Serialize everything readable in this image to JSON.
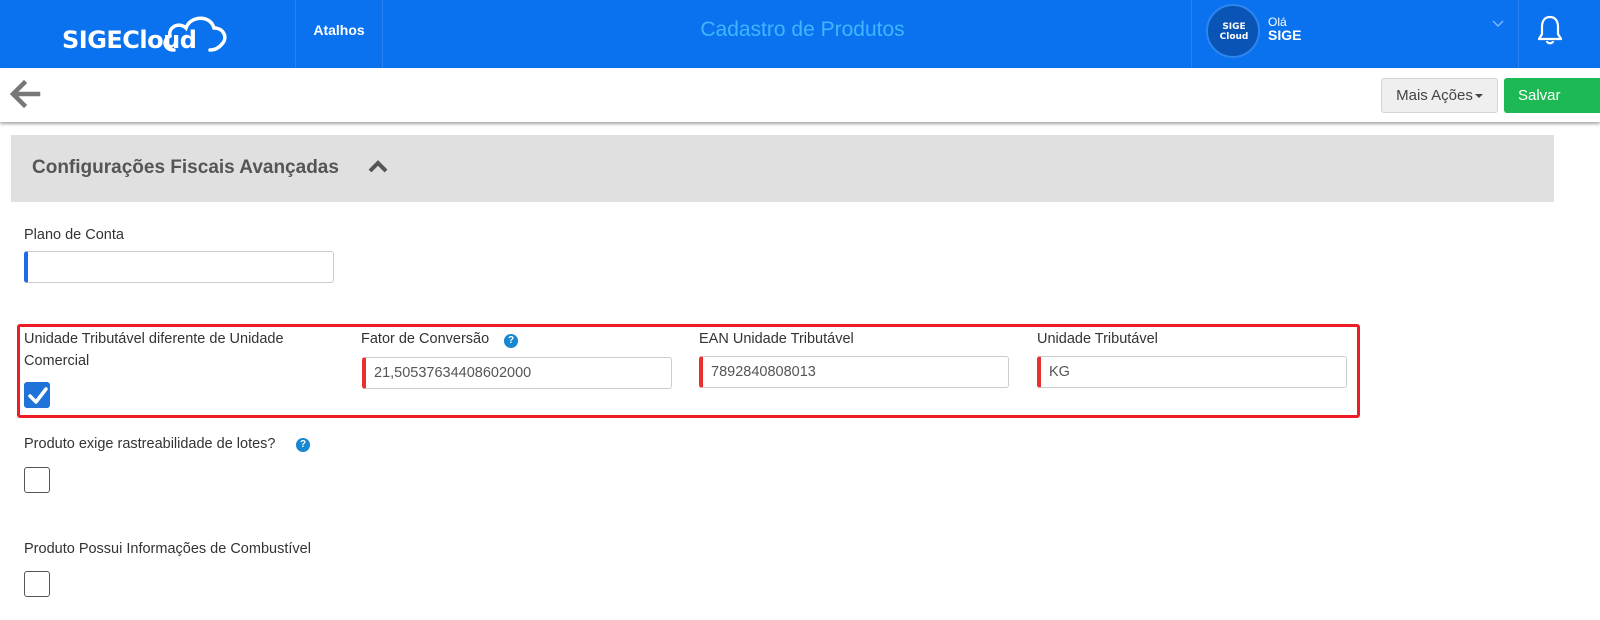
{
  "header": {
    "logo_text": "SIGECloud",
    "shortcuts_label": "Atalhos",
    "page_title": "Cadastro de Produtos",
    "user": {
      "avatar_text": "SIGE Cloud",
      "greeting": "Olá",
      "name": "SIGE"
    },
    "icons": [
      "cloud-icon",
      "chevron-down-icon",
      "bell-icon"
    ]
  },
  "actionbar": {
    "more_actions_label": "Mais Ações",
    "save_label": "Salvar",
    "icons": [
      "back-arrow-icon"
    ]
  },
  "section": {
    "title": "Configurações Fiscais Avançadas",
    "expanded": true,
    "icons": [
      "chevron-up-icon"
    ]
  },
  "form": {
    "plano_de_conta": {
      "label": "Plano de Conta",
      "value": ""
    },
    "unidade_tributavel_diferente": {
      "label_line1": "Unidade Tributável diferente de Unidade",
      "label_line2": "Comercial",
      "checked": true
    },
    "fator_conversao": {
      "label": "Fator de Conversão",
      "value": "21,50537634408602000",
      "help": "?"
    },
    "ean_unidade_tributavel": {
      "label": "EAN Unidade Tributável",
      "value": "7892840808013"
    },
    "unidade_tributavel": {
      "label": "Unidade Tributável",
      "value": "KG"
    },
    "rastreabilidade": {
      "label": "Produto exige rastreabilidade de lotes?",
      "checked": false,
      "help": "?"
    },
    "combustivel": {
      "label": "Produto Possui Informações de Combustível",
      "checked": false
    }
  },
  "colors": {
    "header_bg": "#0b72ef",
    "title_color": "#3db6ff",
    "save_green": "#1db954",
    "highlight_red": "#ee1c25",
    "required_red": "#e8312f",
    "focus_blue": "#1e6be8",
    "checkbox_blue": "#1e72d8"
  }
}
